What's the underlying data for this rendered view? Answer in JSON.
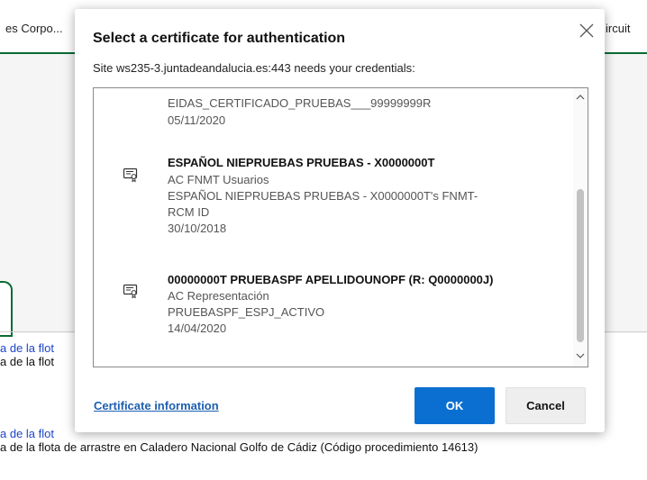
{
  "background": {
    "tab_left": "es Corpo...",
    "tab_right": "ircuit",
    "lines": [
      "a de la flot",
      "a de la flot",
      "a de la flot",
      "a de la flota de arrastre en Caladero Nacional Golfo de Cádiz (Código procedimiento 14613)"
    ]
  },
  "dialog": {
    "title": "Select a certificate for authentication",
    "subtitle": "Site ws235-3.juntadeandalucia.es:443 needs your credentials:",
    "certificates": [
      {
        "lines": [
          "EIDAS_CERTIFICADO_PRUEBAS___99999999R",
          "05/11/2020"
        ]
      },
      {
        "name": "ESPAÑOL NIEPRUEBAS PRUEBAS - X0000000T",
        "lines": [
          "AC FNMT Usuarios",
          "ESPAÑOL NIEPRUEBAS PRUEBAS - X0000000T's FNMT-",
          "RCM ID",
          "30/10/2018"
        ]
      },
      {
        "name": "00000000T PRUEBASPF APELLIDOUNOPF (R: Q0000000J)",
        "lines": [
          "AC Representación",
          "PRUEBASPF_ESPJ_ACTIVO",
          "14/04/2020"
        ]
      }
    ],
    "cert_info_link": "Certificate information",
    "ok_label": "OK",
    "cancel_label": "Cancel"
  },
  "colors": {
    "accent": "#0b6fd1",
    "link": "#1d5fb0",
    "brand_green": "#0a6b35"
  }
}
